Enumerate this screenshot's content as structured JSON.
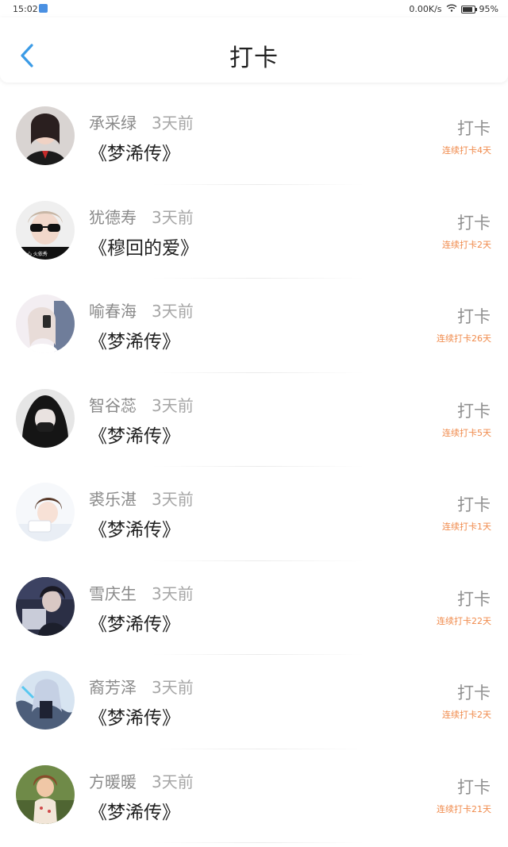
{
  "status_bar": {
    "time": "15:02",
    "network": "0.00K/s",
    "battery": "95%"
  },
  "header": {
    "title": "打卡",
    "back_icon": "chevron-left-icon",
    "accent_color": "#3b9be6"
  },
  "colors": {
    "name": "#8a8a8a",
    "time": "#a6a6a6",
    "book": "#222222",
    "checkin": "#8f8f8f",
    "streak": "#f08a4b"
  },
  "items": [
    {
      "name": "承采绿",
      "time": "3天前",
      "book": "《梦浠传》",
      "checkin": "打卡",
      "streak": "连续打卡4天"
    },
    {
      "name": "犹德寿",
      "time": "3天前",
      "book": "《穆回的爱》",
      "checkin": "打卡",
      "streak": "连续打卡2天"
    },
    {
      "name": "喻春海",
      "time": "3天前",
      "book": "《梦浠传》",
      "checkin": "打卡",
      "streak": "连续打卡26天"
    },
    {
      "name": "智谷蕊",
      "time": "3天前",
      "book": "《梦浠传》",
      "checkin": "打卡",
      "streak": "连续打卡5天"
    },
    {
      "name": "裘乐湛",
      "time": "3天前",
      "book": "《梦浠传》",
      "checkin": "打卡",
      "streak": "连续打卡1天"
    },
    {
      "name": "雪庆生",
      "time": "3天前",
      "book": "《梦浠传》",
      "checkin": "打卡",
      "streak": "连续打卡22天"
    },
    {
      "name": "裔芳泽",
      "time": "3天前",
      "book": "《梦浠传》",
      "checkin": "打卡",
      "streak": "连续打卡2天"
    },
    {
      "name": "方暖暖",
      "time": "3天前",
      "book": "《梦浠传》",
      "checkin": "打卡",
      "streak": "连续打卡21天"
    }
  ]
}
